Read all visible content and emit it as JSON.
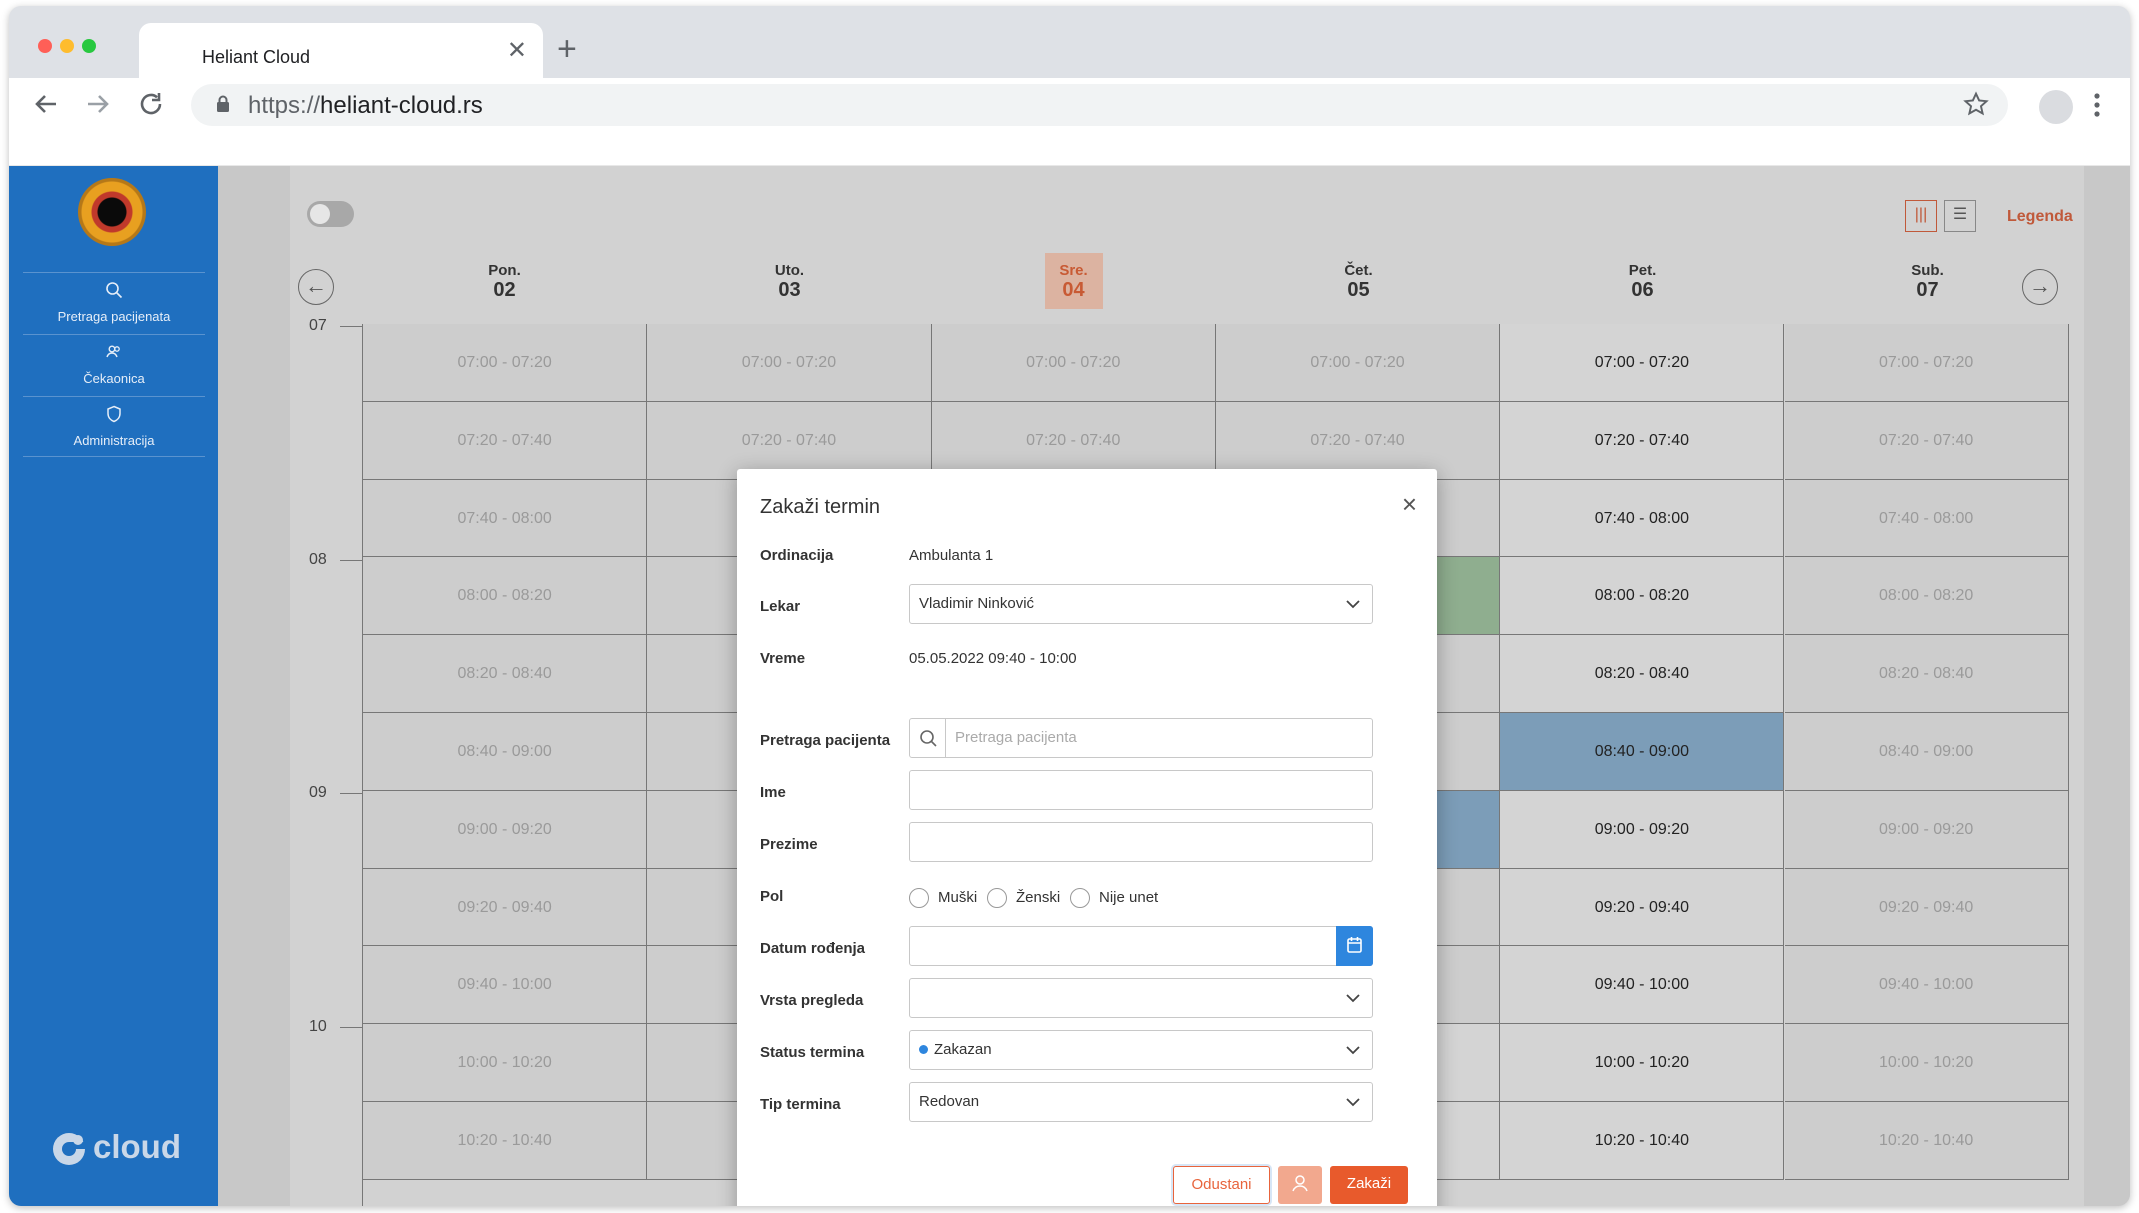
{
  "browser": {
    "tab_title": "Heliant Cloud",
    "url_protocol": "https://",
    "url_host": "heliant-cloud.rs",
    "traffic_light_colors": [
      "#ff5f57",
      "#febc2e",
      "#28c840"
    ]
  },
  "sidebar": {
    "items": [
      {
        "label": "Pretraga pacijenata",
        "icon": "search-icon"
      },
      {
        "label": "Čekaonica",
        "icon": "people-icon"
      },
      {
        "label": "Administracija",
        "icon": "shield-icon"
      }
    ],
    "footer_logo": "cloud",
    "color": "#1f6fbf"
  },
  "calendar": {
    "legend_label": "Legenda",
    "days": [
      {
        "name": "Pon.",
        "date": "02"
      },
      {
        "name": "Uto.",
        "date": "03"
      },
      {
        "name": "Sre.",
        "date": "04",
        "today": true
      },
      {
        "name": "Čet.",
        "date": "05"
      },
      {
        "name": "Pet.",
        "date": "06"
      },
      {
        "name": "Sub.",
        "date": "07"
      }
    ],
    "hours": [
      "07",
      "08",
      "09",
      "10"
    ],
    "slots": [
      "07:00 - 07:20",
      "07:20 - 07:40",
      "07:40 - 08:00",
      "08:00 - 08:20",
      "08:20 - 08:40",
      "08:40 - 09:00",
      "09:00 - 09:20",
      "09:20 - 09:40",
      "09:40 - 10:00",
      "10:00 - 10:20",
      "10:20 - 10:40"
    ]
  },
  "modal": {
    "title": "Zakaži termin",
    "fields": {
      "ordinacija": {
        "label": "Ordinacija",
        "value": "Ambulanta 1"
      },
      "lekar": {
        "label": "Lekar",
        "value": "Vladimir Ninković"
      },
      "vreme": {
        "label": "Vreme",
        "value": "05.05.2022 09:40 - 10:00"
      },
      "pretraga": {
        "label": "Pretraga pacijenta",
        "placeholder": "Pretraga pacijenta"
      },
      "ime": {
        "label": "Ime",
        "value": ""
      },
      "prezime": {
        "label": "Prezime",
        "value": ""
      },
      "pol": {
        "label": "Pol",
        "options": [
          "Muški",
          "Ženski",
          "Nije unet"
        ]
      },
      "datum": {
        "label": "Datum rođenja",
        "value": ""
      },
      "vrsta": {
        "label": "Vrsta pregleda",
        "value": ""
      },
      "status": {
        "label": "Status termina",
        "value": "Zakazan"
      },
      "tip": {
        "label": "Tip termina",
        "value": "Redovan"
      }
    },
    "buttons": {
      "cancel": "Odustani",
      "schedule": "Zakaži"
    },
    "accent_color": "#e85a2c"
  }
}
